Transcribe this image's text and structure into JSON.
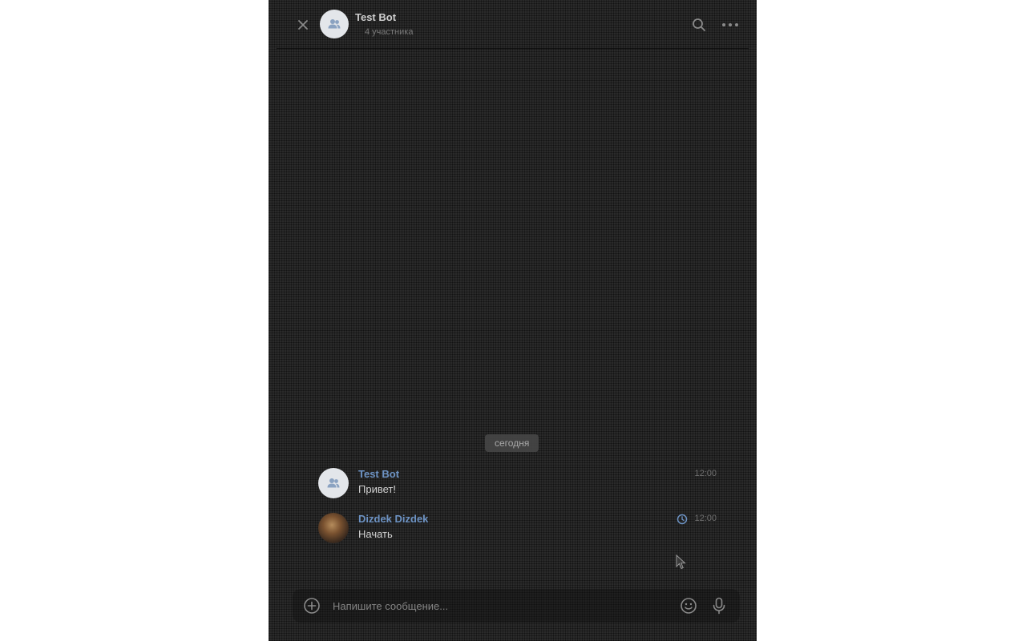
{
  "header": {
    "title": "Test Bot",
    "subtitle": "4 участника",
    "close_icon": "close-icon",
    "search_icon": "search-icon",
    "more_icon": "more-icon"
  },
  "date_separator": "сегодня",
  "messages": [
    {
      "author": "Test Bot",
      "text": "Привет!",
      "time": "12:00",
      "avatar": "group-icon"
    },
    {
      "author": "Dizdek Dizdek",
      "text": "Начать",
      "time": "12:00",
      "avatar": "user-photo",
      "status_icon": "clock-icon"
    }
  ],
  "composer": {
    "placeholder": "Напишите сообщение...",
    "attach_icon": "plus-circle-icon",
    "emoji_icon": "smile-icon",
    "mic_icon": "microphone-icon"
  },
  "colors": {
    "background": "#2a2a2a",
    "author": "#6d93c4",
    "text": "#d2d2d2",
    "muted": "#7a7a7a"
  }
}
